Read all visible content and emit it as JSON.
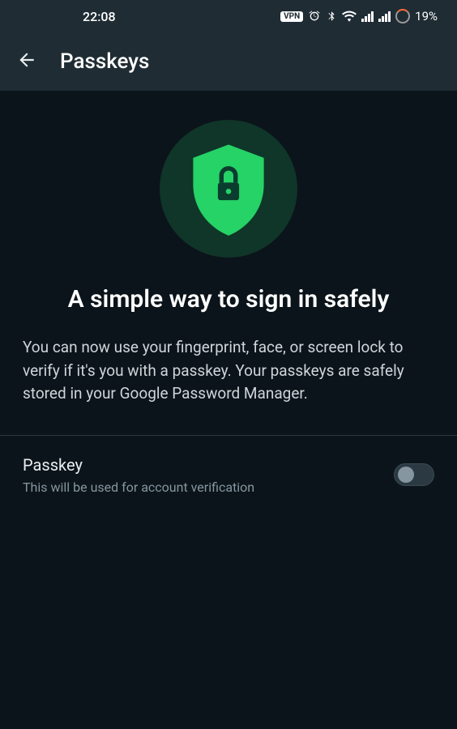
{
  "statusBar": {
    "time": "22:08",
    "vpn": "VPN",
    "battery": "19%"
  },
  "appBar": {
    "title": "Passkeys"
  },
  "hero": {
    "headline": "A simple way to sign in safely",
    "description": "You can now use your fingerprint, face, or screen lock to verify if it's you with a passkey. Your passkeys are safely stored in your Google Password Manager."
  },
  "setting": {
    "title": "Passkey",
    "subtitle": "This will be used for account verification",
    "enabled": false
  }
}
